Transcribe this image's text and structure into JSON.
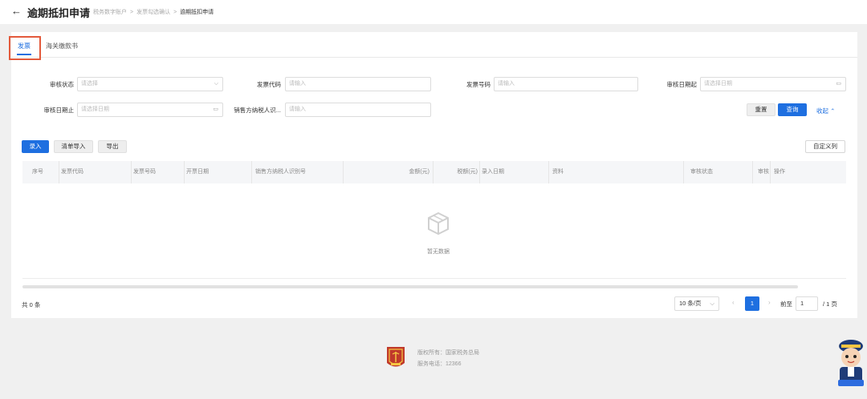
{
  "header": {
    "back_icon": "arrow-left-icon",
    "title": "逾期抵扣申请",
    "breadcrumbs": [
      "税务数字账户",
      "发票勾选确认",
      "逾期抵扣申请"
    ]
  },
  "tabs": [
    {
      "label": "发票",
      "active": true
    },
    {
      "label": "海关缴款书",
      "active": false
    }
  ],
  "filters": {
    "review_status": {
      "label": "审核状态",
      "placeholder": "请选择"
    },
    "invoice_code": {
      "label": "发票代码",
      "placeholder": "请输入"
    },
    "invoice_number": {
      "label": "发票号码",
      "placeholder": "请输入"
    },
    "review_date_start": {
      "label": "审核日期起",
      "placeholder": "请选择日期"
    },
    "review_date_end": {
      "label": "审核日期止",
      "placeholder": "请选择日期"
    },
    "seller_tax_id": {
      "label": "销售方纳税人识...",
      "placeholder": "请输入"
    }
  },
  "actions": {
    "reset": "重置",
    "query": "查询",
    "collapse": "收起",
    "entry": "录入",
    "list_import": "清单导入",
    "export": "导出",
    "custom_columns": "自定义列"
  },
  "table": {
    "columns": [
      "序号",
      "发票代码",
      "发票号码",
      "开票日期",
      "销售方纳税人识别号",
      "金额(元)",
      "税额(元)",
      "录入日期",
      "资料",
      "审核状态",
      "审核",
      "操作"
    ],
    "rows": [],
    "empty_text": "暂无数据"
  },
  "pagination": {
    "total_text": "共 0 条",
    "page_size": "10 条/页",
    "current_page": "1",
    "goto_label": "前至",
    "goto_value": "1",
    "total_pages": "/ 1 页"
  },
  "footer": {
    "copyright": "版权所有：国家税务总局",
    "hotline": "服务电话：12366"
  },
  "colors": {
    "primary": "#1e6fe0",
    "highlight_box": "#e35a3c",
    "emblem": "#c0392b"
  }
}
